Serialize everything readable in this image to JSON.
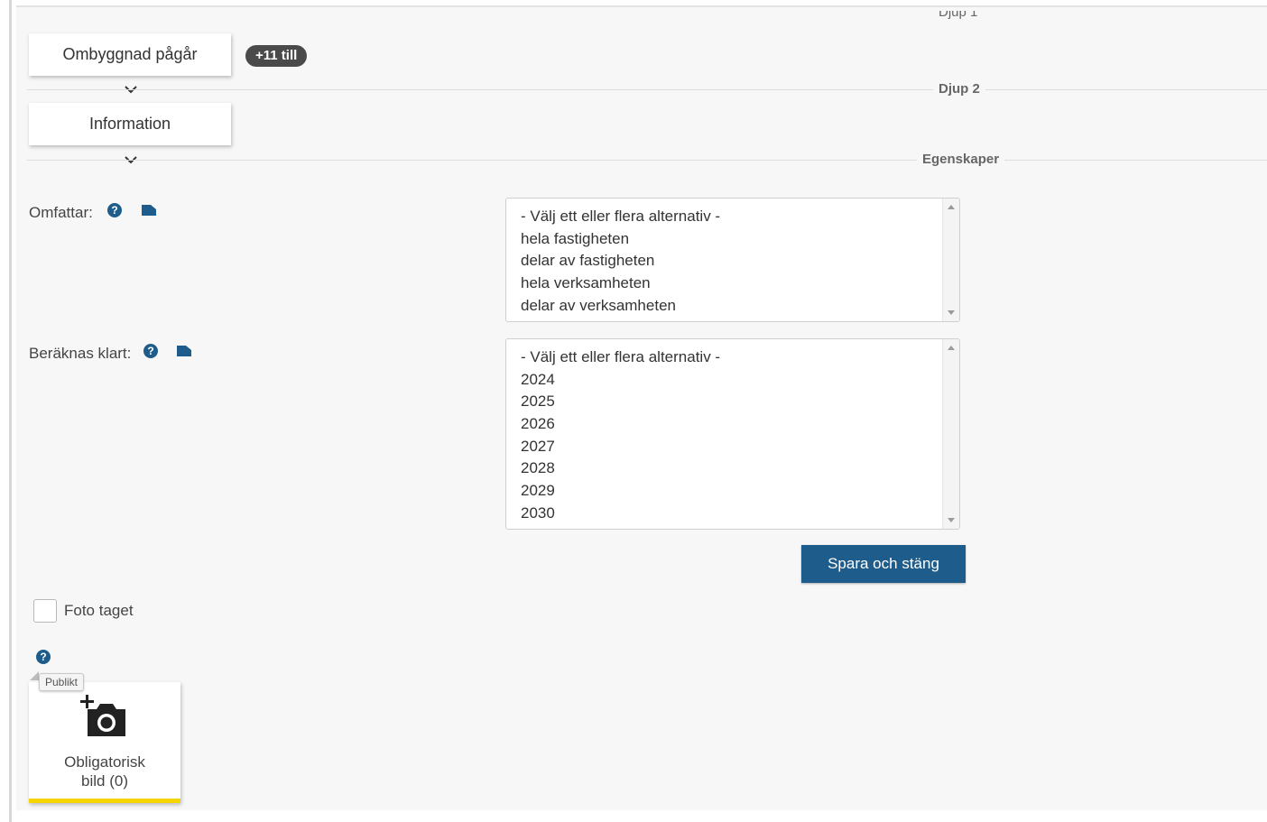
{
  "tags": {
    "first_tag": "Ombyggnad pågår",
    "more_badge": "+11 till",
    "second_tag": "Information"
  },
  "sections": {
    "depth1_partial": "Djup 1",
    "depth2": "Djup 2",
    "properties": "Egenskaper"
  },
  "fields": {
    "omfattar": {
      "label": "Omfattar:",
      "options": [
        "- Välj ett eller flera alternativ -",
        "hela fastigheten",
        "delar av fastigheten",
        "hela verksamheten",
        "delar av verksamheten"
      ]
    },
    "beraknas_klart": {
      "label": "Beräknas klart:",
      "options": [
        "- Välj ett eller flera alternativ -",
        "2024",
        "2025",
        "2026",
        "2027",
        "2028",
        "2029",
        "2030"
      ]
    }
  },
  "actions": {
    "save_close": "Spara och stäng"
  },
  "photo": {
    "checkbox_label": "Foto taget",
    "checked": false,
    "badge": "Publikt",
    "card_label_line1": "Obligatorisk",
    "card_label_line2": "bild (0)"
  },
  "colors": {
    "primary": "#1e5d8b",
    "accent_yellow": "#f5d400",
    "badge_dark": "#4a4a4a"
  },
  "icons": [
    "chevron-down-icon",
    "help-icon",
    "folder-icon",
    "add-photo-icon"
  ]
}
